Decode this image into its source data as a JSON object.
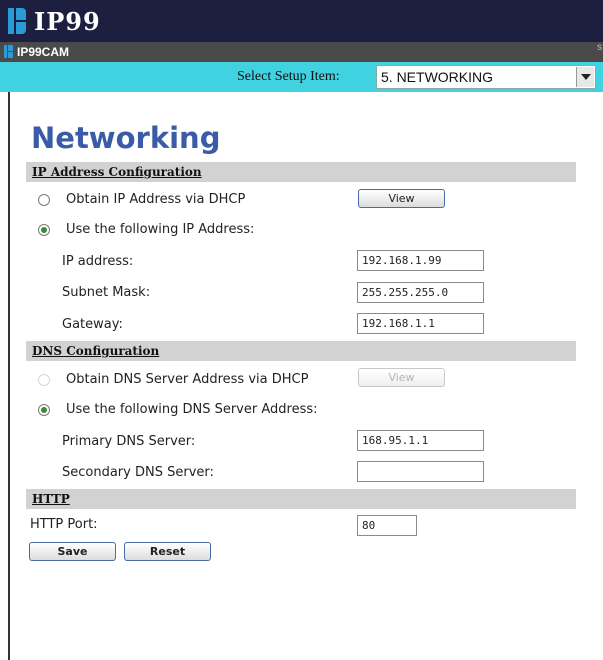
{
  "header": {
    "brand": "IP99",
    "sub_title": "IP99CAM",
    "edge_mark": "s"
  },
  "setup": {
    "label": "Select Setup Item:",
    "selected": "5. NETWORKING"
  },
  "page": {
    "title": "Networking"
  },
  "ip_section": {
    "heading": "IP Address Configuration",
    "dhcp_label": "Obtain IP Address via DHCP",
    "view_label": "View",
    "static_label": "Use the following IP Address:",
    "mode": "static",
    "ip_label": "IP address:",
    "ip_value": "192.168.1.99",
    "mask_label": "Subnet Mask:",
    "mask_value": "255.255.255.0",
    "gateway_label": "Gateway:",
    "gateway_value": "192.168.1.1"
  },
  "dns_section": {
    "heading": "DNS Configuration",
    "dhcp_label": "Obtain DNS Server Address via DHCP",
    "view_label": "View",
    "static_label": "Use the following DNS Server Address:",
    "mode": "static",
    "primary_label": "Primary DNS Server:",
    "primary_value": "168.95.1.1",
    "secondary_label": "Secondary DNS Server:",
    "secondary_value": ""
  },
  "http_section": {
    "heading": "HTTP",
    "port_label": "HTTP Port:",
    "port_value": "80"
  },
  "actions": {
    "save_label": "Save",
    "reset_label": "Reset"
  },
  "colors": {
    "brand_bar": "#1c1f3f",
    "setup_bar": "#40d2e0",
    "title": "#3a5ba6",
    "section_bg": "#d2d2d2"
  }
}
